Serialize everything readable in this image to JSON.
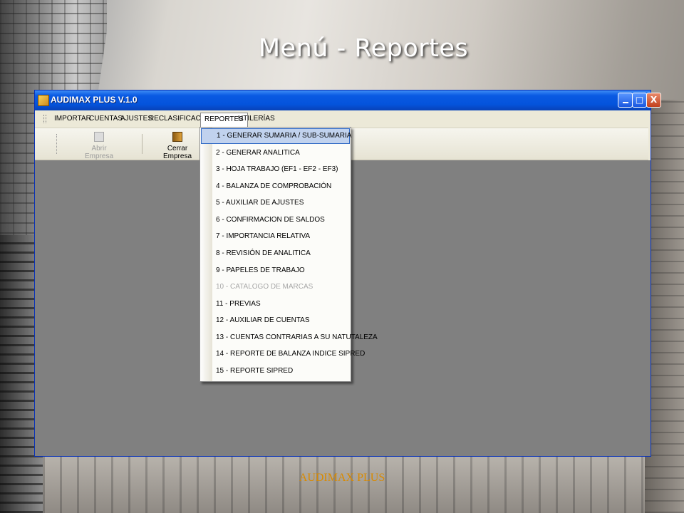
{
  "slide": {
    "title": "Menú - Reportes",
    "footer": "AUDIMAX PLUS"
  },
  "window": {
    "title": "AUDIMAX PLUS V.1.0",
    "controls": {
      "minimize": "_",
      "maximize": "□",
      "close": "X"
    }
  },
  "menu": {
    "items": [
      "IMPORTAR",
      "CUENTAS",
      "AJUSTES",
      "RECLASIFICACIÓN",
      "REPORTES",
      "UTILERÍAS"
    ],
    "open": "REPORTES"
  },
  "toolbar": {
    "abrir": {
      "label": "Abrir Empresa",
      "icon": "folder-open-icon",
      "enabled": false
    },
    "cerrar": {
      "label": "Cerrar Empresa",
      "icon": "exit-door-icon",
      "enabled": true
    }
  },
  "reportes_menu": {
    "items": [
      "1 - GENERAR SUMARIA / SUB-SUMARIA",
      "2 - GENERAR ANALITICA",
      "3 - HOJA TRABAJO (EF1 - EF2 - EF3)",
      "4 - BALANZA DE COMPROBACIÓN",
      "5 - AUXILIAR DE AJUSTES",
      "6 - CONFIRMACION DE SALDOS",
      "7 - IMPORTANCIA RELATIVA",
      "8 - REVISIÓN DE ANALITICA",
      "9 - PAPELES DE TRABAJO",
      "10 - CATALOGO DE MARCAS",
      "11 - PREVIAS",
      "12 - AUXILIAR DE CUENTAS",
      "13 - CUENTAS CONTRARIAS A SU NATUTALEZA",
      "14 - REPORTE DE BALANZA INDICE SIPRED",
      "15 - REPORTE SIPRED"
    ],
    "selected_index": 0,
    "disabled_index": 9
  },
  "colors": {
    "titlebar": "#0453db",
    "menu_background": "#ece9d8",
    "highlight": "#c1d2ee",
    "highlight_border": "#316ac5",
    "workspace": "#808080",
    "footer": "#d98a00"
  }
}
